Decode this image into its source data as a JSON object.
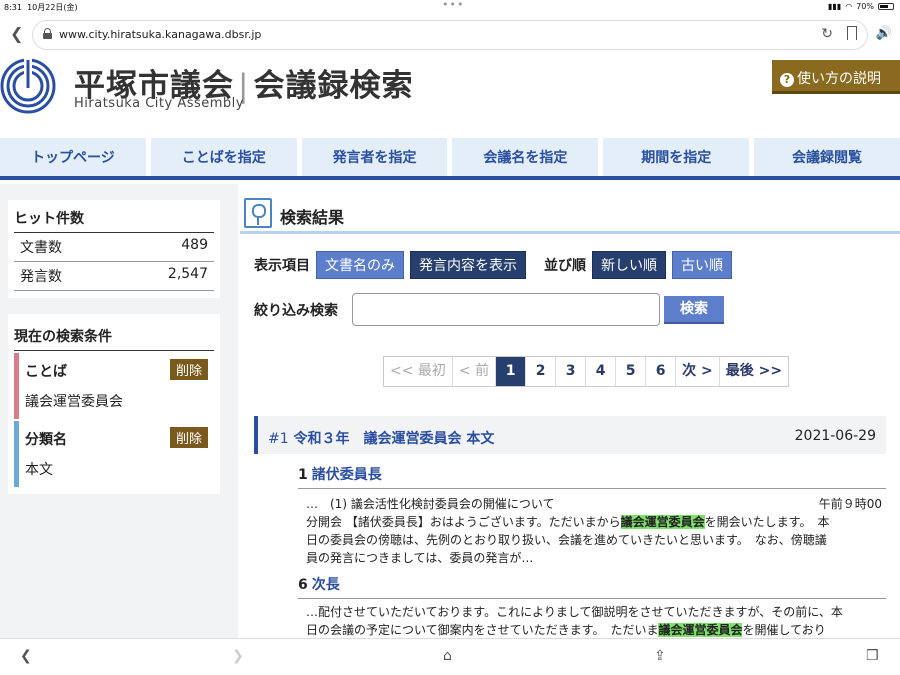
{
  "status_bar": {
    "time": "8:31",
    "date": "10月22日(金)",
    "battery": "70%",
    "battery_level": 0.7
  },
  "browser": {
    "url": "www.city.hiratsuka.kanagawa.dbsr.jp"
  },
  "header": {
    "title_part1": "平塚市議会",
    "title_part2": "会議録検索",
    "subtitle": "Hiratsuka City Assembly",
    "help_label": "使い方の説明"
  },
  "nav": {
    "items": [
      {
        "label": "トップページ"
      },
      {
        "label": "ことばを指定"
      },
      {
        "label": "発言者を指定"
      },
      {
        "label": "会議名を指定"
      },
      {
        "label": "期間を指定"
      },
      {
        "label": "会議録閲覧"
      }
    ]
  },
  "sidebar": {
    "hits_title": "ヒット件数",
    "hits": [
      {
        "label": "文書数",
        "value": "489"
      },
      {
        "label": "発言数",
        "value": "2,547"
      }
    ],
    "conditions_title": "現在の検索条件",
    "delete_label": "削除",
    "conditions": [
      {
        "label": "ことば",
        "value": "議会運営委員会"
      },
      {
        "label": "分類名",
        "value": "本文"
      }
    ]
  },
  "main": {
    "title": "検索結果",
    "display_label": "表示項目",
    "display_opt1": "文書名のみ",
    "display_opt2": "発言内容を表示",
    "sort_label": "並び順",
    "sort_opt1": "新しい順",
    "sort_opt2": "古い順",
    "filter_label": "絞り込み検索",
    "filter_value": "",
    "search_button": "検索"
  },
  "pager": {
    "first": "<< 最初",
    "prev": "< 前",
    "pages": [
      "1",
      "2",
      "3",
      "4",
      "5",
      "6"
    ],
    "next": "次 >",
    "last": "最後 >>"
  },
  "result": {
    "number": "#1",
    "title": "令和３年　議会運営委員会 本文",
    "date": "2021-06-29"
  },
  "speakers": [
    {
      "num": "1",
      "name": "諸伏委員長",
      "line1_a": "…　(1) 議会活性化検討委員会の開催について",
      "line1_time": "午前９時00",
      "line2_a": "分開会 【諸伏委員長】おはようございます。ただいまから",
      "line2_hl": "議会運営委員会",
      "line2_b": "を開会いたします。　本",
      "line3": "日の委員会の傍聴は、先例のとおり取り扱い、会議を進めていきたいと思います。　なお、傍聴議",
      "line4": "員の発言につきましては、委員の発言が…"
    },
    {
      "num": "6",
      "name": "次長",
      "line1": "…配付させていただいております。これによりまして御説明をさせていただきますが、その前に、本",
      "line2_a": "日の会議の予定について御案内をさせていただきます。　ただいま",
      "line2_hl": "議会運営委員会",
      "line2_b": "を開催しており"
    }
  ]
}
